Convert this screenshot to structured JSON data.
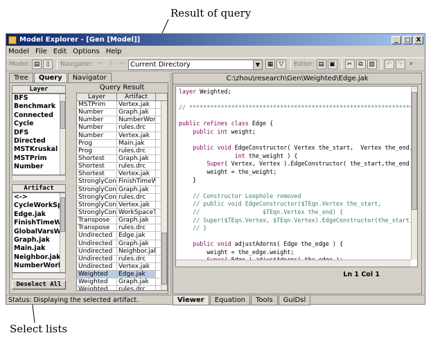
{
  "annotations": {
    "result_of_query": "Result of query",
    "select_lists": "Select lists"
  },
  "window": {
    "title": "Model Explorer - [Gen [Model]]",
    "controls": [
      "_",
      "□",
      "X"
    ]
  },
  "menu": [
    "Model",
    "File",
    "Edit",
    "Options",
    "Help"
  ],
  "toolbar": {
    "model_label": "Model:",
    "navigator_label": "Navigator:",
    "navigator_value": "Current Directory",
    "editor_label": "Editor:"
  },
  "left_tabs": [
    "Tree",
    "Query",
    "Navigator"
  ],
  "layer_list": {
    "header": "Layer",
    "items": [
      "BFS",
      "Benchmark",
      "Connected",
      "Cycle",
      "DFS",
      "Directed",
      "MSTKruskal",
      "MSTPrim",
      "Number"
    ]
  },
  "artifact_list": {
    "header": "Artifact",
    "items": [
      "<->",
      "CycleWorkSpace",
      "Edge.jak",
      "FinishTimeWorkS",
      "GlobalVarsWrapp",
      "Graph.jak",
      "Main.jak",
      "Neighbor.jak",
      "NumberWorkSpa"
    ]
  },
  "deselect_label": "Deselect All",
  "query_result": {
    "title": "Query Result",
    "columns": [
      "Layer",
      "Artifact"
    ],
    "rows": [
      [
        "MSTPrim",
        "Vertex.jak"
      ],
      [
        "Number",
        "Graph.jak"
      ],
      [
        "Number",
        "NumberWork..."
      ],
      [
        "Number",
        "rules.drc"
      ],
      [
        "Number",
        "Vertex.jak"
      ],
      [
        "Prog",
        "Main.jak"
      ],
      [
        "Prog",
        "rules.drc"
      ],
      [
        "Shortest",
        "Graph.jak"
      ],
      [
        "Shortest",
        "rules.drc"
      ],
      [
        "Shortest",
        "Vertex.jak"
      ],
      [
        "StronglyConn...",
        "FinishTimeW..."
      ],
      [
        "StronglyConn...",
        "Graph.jak"
      ],
      [
        "StronglyConn...",
        "rules.drc"
      ],
      [
        "StronglyConn...",
        "Vertex.jak"
      ],
      [
        "StronglyConn...",
        "WorkSpaceT..."
      ],
      [
        "Transpose",
        "Graph.jak"
      ],
      [
        "Transpose",
        "rules.drc"
      ],
      [
        "Undirected",
        "Edge.jak"
      ],
      [
        "Undirected",
        "Graph.jak"
      ],
      [
        "Undirected",
        "Neighbor.jak"
      ],
      [
        "Undirected",
        "rules.drc"
      ],
      [
        "Undirected",
        "Vertex.jak"
      ],
      [
        "Weighted",
        "Edge.jak"
      ],
      [
        "Weighted",
        "Graph.jak"
      ],
      [
        "Weighted",
        "rules.drc"
      ]
    ],
    "selected_index": 22
  },
  "editor": {
    "file_path": "C:\\zhou\\research\\Gen\\Weighted\\Edge.jak",
    "position": "Ln 1    Col 1"
  },
  "right_tabs": [
    "Viewer",
    "Equation",
    "Tools",
    "GuiDsl"
  ],
  "status": "Status: Displaying the selected artifact."
}
